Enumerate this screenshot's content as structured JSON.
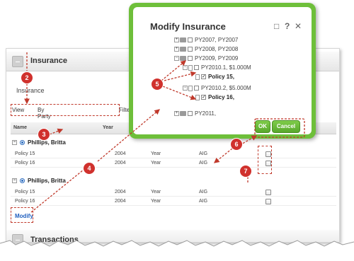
{
  "insurance": {
    "section_title": "Insurance",
    "sub_label": "Insurance",
    "view_label": "View",
    "view_value": "By Party",
    "filter_label": "Filter"
  },
  "grid": {
    "columns": [
      "Name",
      "Year"
    ],
    "groups": [
      {
        "name": "Phillips, Britta",
        "rows": [
          {
            "policy": "Policy 15",
            "year": "2004",
            "period": "Year",
            "carrier": "AIG"
          },
          {
            "policy": "Policy 16",
            "year": "2004",
            "period": "Year",
            "carrier": "AIG"
          }
        ]
      },
      {
        "name": "Phillips, Britta",
        "rows": [
          {
            "policy": "Policy 15",
            "year": "2004",
            "period": "Year",
            "carrier": "AIG"
          },
          {
            "policy": "Policy 16",
            "year": "2004",
            "period": "Year",
            "carrier": "AIG"
          }
        ]
      }
    ]
  },
  "modify_link": "Modify",
  "transactions": {
    "section_title": "Transactions"
  },
  "dialog": {
    "title": "Modify Insurance",
    "icons": {
      "maximize": "□",
      "help": "?",
      "close": "✕"
    },
    "tree": [
      "PY2007, PY2007",
      "PY2008, PY2008",
      "PY2009, PY2009",
      "PY2010.1, $1.000M",
      "Policy 15,",
      "PY2010.2, $5.000M",
      "Policy 16,",
      "PY2011,"
    ],
    "ok_label": "OK",
    "cancel_label": "Cancel"
  },
  "callouts": [
    "2",
    "3",
    "4",
    "5",
    "6",
    "7"
  ],
  "colors": {
    "accent_green": "#6ebf3a",
    "callout_red": "#d0312d",
    "link_blue": "#1f5fbf"
  }
}
